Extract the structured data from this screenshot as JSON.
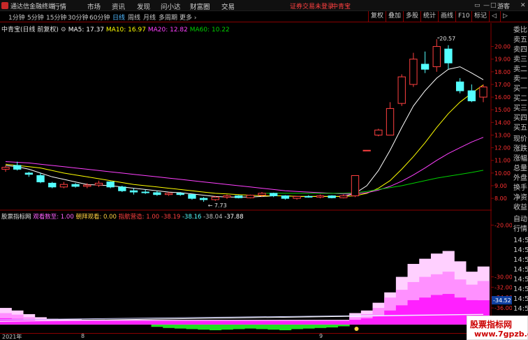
{
  "app": {
    "title": "通达信金融终端",
    "notice": "证券交易未登录",
    "stock_top": "中青宝",
    "guest": "游客"
  },
  "menu": [
    "行情",
    "市场",
    "资讯",
    "发现",
    "问小达",
    "财富圈",
    "交易"
  ],
  "window_controls": [
    "▭",
    "—",
    "□",
    "✕"
  ],
  "timeframes": [
    {
      "label": "1分钟",
      "active": false
    },
    {
      "label": "5分钟",
      "active": false
    },
    {
      "label": "15分钟",
      "active": false
    },
    {
      "label": "30分钟",
      "active": false
    },
    {
      "label": "60分钟",
      "active": false
    },
    {
      "label": "日线",
      "active": true
    },
    {
      "label": "周线",
      "active": false
    },
    {
      "label": "月线",
      "active": false
    },
    {
      "label": "多周期",
      "active": false
    },
    {
      "label": "更多 ›",
      "active": false
    }
  ],
  "tool_buttons": [
    "复权",
    "叠加",
    "多股",
    "统计",
    "画线",
    "F10",
    "标记",
    "◁",
    "▷"
  ],
  "main_header": {
    "title": "中青宝(日线 前复权)",
    "ma5": "MA5: 17.37",
    "ma10": "MA10: 16.97",
    "ma20": "MA20: 12.82",
    "ma60": "MA60: 10.22"
  },
  "sub_header": {
    "title": "股票指标网",
    "i1_name": "观看数至:",
    "i1_val": "1.00",
    "i2_name": "朝拜观看:",
    "i2_val": "0.00",
    "i3_name": "指航营造:",
    "i3_val": "1.00",
    "v1": "-38.19",
    "v2": "-38.16",
    "v3": "-38.04",
    "v4": "-37.88"
  },
  "annotations": {
    "high": "20.57",
    "low": "← 7.73"
  },
  "date_axis": [
    "2021年",
    "8",
    "9"
  ],
  "right_panel": [
    "委比",
    "卖五",
    "卖四",
    "卖三",
    "卖二",
    "卖一",
    "买一",
    "买二",
    "买三",
    "买四",
    "买五",
    "现价",
    "涨跌",
    "涨幅",
    "总量",
    "外盘",
    "换手",
    "净资",
    "收益",
    "",
    "自动",
    "行情",
    "14:5",
    "14:5",
    "14:5",
    "14:5",
    "14:5",
    "14:5",
    "14:5",
    "14:5"
  ],
  "watermark": {
    "line1": "股票指标网",
    "line2": "www.7gpzb.com"
  },
  "colors": {
    "up": "#ff4040",
    "down": "#54ffff",
    "ma5": "#ffffff",
    "ma10": "#ffff00",
    "ma20": "#ff40ff",
    "ma60": "#00d000",
    "frame": "#8a0000"
  },
  "chart_data": [
    {
      "type": "candlestick",
      "title": "中青宝(日线 前复权)",
      "y_ticks": [
        8.0,
        9.0,
        10.0,
        11.0,
        12.0,
        13.0,
        14.0,
        15.0,
        16.0,
        17.0,
        18.0,
        19.0,
        20.0
      ],
      "ylim": [
        7.4,
        21.3
      ],
      "high_label": 20.57,
      "low_label": 7.73,
      "candles": [
        {
          "o": 10.3,
          "h": 10.6,
          "l": 10.1,
          "c": 10.45
        },
        {
          "o": 10.6,
          "h": 10.9,
          "l": 10.2,
          "c": 10.3
        },
        {
          "o": 10.0,
          "h": 10.1,
          "l": 9.7,
          "c": 9.9
        },
        {
          "o": 9.8,
          "h": 10.0,
          "l": 9.2,
          "c": 9.3
        },
        {
          "o": 9.2,
          "h": 9.3,
          "l": 8.8,
          "c": 8.9
        },
        {
          "o": 8.9,
          "h": 9.3,
          "l": 8.8,
          "c": 9.1
        },
        {
          "o": 9.1,
          "h": 9.2,
          "l": 8.85,
          "c": 8.95
        },
        {
          "o": 8.95,
          "h": 9.2,
          "l": 8.8,
          "c": 9.05
        },
        {
          "o": 9.05,
          "h": 9.4,
          "l": 8.9,
          "c": 9.2
        },
        {
          "o": 9.3,
          "h": 9.35,
          "l": 8.8,
          "c": 8.9
        },
        {
          "o": 8.9,
          "h": 9.0,
          "l": 8.5,
          "c": 8.6
        },
        {
          "o": 8.6,
          "h": 8.8,
          "l": 8.3,
          "c": 8.5
        },
        {
          "o": 8.5,
          "h": 8.7,
          "l": 8.35,
          "c": 8.45
        },
        {
          "o": 8.45,
          "h": 8.6,
          "l": 8.2,
          "c": 8.3
        },
        {
          "o": 8.3,
          "h": 8.5,
          "l": 8.2,
          "c": 8.4
        },
        {
          "o": 8.4,
          "h": 8.5,
          "l": 8.2,
          "c": 8.3
        },
        {
          "o": 8.3,
          "h": 8.35,
          "l": 7.9,
          "c": 8.0
        },
        {
          "o": 8.0,
          "h": 8.1,
          "l": 7.73,
          "c": 7.9
        },
        {
          "o": 7.9,
          "h": 8.2,
          "l": 7.8,
          "c": 8.1
        },
        {
          "o": 8.1,
          "h": 8.3,
          "l": 7.95,
          "c": 8.2
        },
        {
          "o": 8.2,
          "h": 8.25,
          "l": 8.0,
          "c": 8.05
        },
        {
          "o": 8.05,
          "h": 8.3,
          "l": 8.0,
          "c": 8.25
        },
        {
          "o": 8.25,
          "h": 8.5,
          "l": 8.1,
          "c": 8.4
        },
        {
          "o": 8.4,
          "h": 8.45,
          "l": 8.1,
          "c": 8.2
        },
        {
          "o": 8.2,
          "h": 8.25,
          "l": 7.9,
          "c": 8.0
        },
        {
          "o": 8.0,
          "h": 8.2,
          "l": 7.9,
          "c": 8.15
        },
        {
          "o": 8.15,
          "h": 8.25,
          "l": 8.05,
          "c": 8.1
        },
        {
          "o": 8.1,
          "h": 8.3,
          "l": 8.0,
          "c": 8.2
        },
        {
          "o": 8.2,
          "h": 8.25,
          "l": 8.0,
          "c": 8.05
        },
        {
          "o": 8.05,
          "h": 8.3,
          "l": 8.0,
          "c": 8.2
        },
        {
          "o": 8.2,
          "h": 9.8,
          "l": 8.1,
          "c": 9.8
        },
        {
          "o": 11.8,
          "h": 11.8,
          "l": 11.8,
          "c": 11.8
        },
        {
          "o": 13.0,
          "h": 13.5,
          "l": 12.9,
          "c": 13.4
        },
        {
          "o": 13.0,
          "h": 15.6,
          "l": 13.0,
          "c": 15.1
        },
        {
          "o": 15.5,
          "h": 17.8,
          "l": 15.3,
          "c": 17.6
        },
        {
          "o": 17.0,
          "h": 19.5,
          "l": 16.8,
          "c": 19.0
        },
        {
          "o": 18.6,
          "h": 19.6,
          "l": 17.9,
          "c": 18.2
        },
        {
          "o": 18.4,
          "h": 20.57,
          "l": 18.0,
          "c": 20.0
        },
        {
          "o": 19.8,
          "h": 20.1,
          "l": 18.2,
          "c": 18.7
        },
        {
          "o": 17.2,
          "h": 17.5,
          "l": 16.3,
          "c": 16.5
        },
        {
          "o": 16.5,
          "h": 17.0,
          "l": 15.6,
          "c": 15.7
        },
        {
          "o": 16.0,
          "h": 17.0,
          "l": 15.6,
          "c": 16.8
        }
      ],
      "ma_series": [
        {
          "name": "MA5",
          "color": "#ffffff",
          "values": [
            10.6,
            10.5,
            10.3,
            10.0,
            9.7,
            9.5,
            9.3,
            9.1,
            9.05,
            9.0,
            8.9,
            8.8,
            8.7,
            8.6,
            8.5,
            8.45,
            8.35,
            8.25,
            8.15,
            8.1,
            8.1,
            8.1,
            8.15,
            8.2,
            8.2,
            8.15,
            8.15,
            8.15,
            8.15,
            8.15,
            8.4,
            9.0,
            10.2,
            11.8,
            13.6,
            15.3,
            16.5,
            17.5,
            18.2,
            18.4,
            17.9,
            17.37
          ]
        },
        {
          "name": "MA10",
          "color": "#ffff00",
          "values": [
            10.7,
            10.6,
            10.5,
            10.4,
            10.2,
            10.0,
            9.85,
            9.7,
            9.55,
            9.4,
            9.25,
            9.1,
            9.0,
            8.9,
            8.8,
            8.7,
            8.6,
            8.5,
            8.4,
            8.35,
            8.3,
            8.25,
            8.2,
            8.2,
            8.2,
            8.15,
            8.15,
            8.15,
            8.15,
            8.15,
            8.2,
            8.4,
            8.8,
            9.4,
            10.3,
            11.3,
            12.4,
            13.6,
            14.7,
            15.6,
            16.3,
            16.97
          ]
        },
        {
          "name": "MA20",
          "color": "#ff40ff",
          "values": [
            10.9,
            10.85,
            10.8,
            10.7,
            10.6,
            10.5,
            10.4,
            10.3,
            10.2,
            10.1,
            10.0,
            9.9,
            9.8,
            9.7,
            9.6,
            9.5,
            9.4,
            9.3,
            9.2,
            9.1,
            9.0,
            8.9,
            8.8,
            8.7,
            8.6,
            8.55,
            8.5,
            8.45,
            8.4,
            8.35,
            8.35,
            8.45,
            8.65,
            8.95,
            9.35,
            9.85,
            10.4,
            11.0,
            11.55,
            12.0,
            12.45,
            12.82
          ]
        },
        {
          "name": "MA60",
          "color": "#00d000",
          "values": [
            null,
            null,
            null,
            null,
            null,
            null,
            null,
            null,
            null,
            null,
            null,
            null,
            null,
            null,
            null,
            null,
            null,
            null,
            null,
            null,
            null,
            null,
            8.4,
            8.4,
            8.4,
            8.4,
            8.4,
            8.4,
            8.4,
            8.4,
            8.45,
            8.55,
            8.7,
            8.85,
            9.0,
            9.2,
            9.4,
            9.6,
            9.75,
            9.9,
            10.05,
            10.22
          ]
        }
      ]
    },
    {
      "type": "area",
      "title": "股票指标网",
      "y_ticks": [
        -20.0,
        -30.0,
        -32.0,
        -34.0,
        -36.0,
        -38.0
      ],
      "current_label": -34.52,
      "ylim": [
        -39.5,
        -19
      ],
      "layers": [
        {
          "name": "观看数至",
          "color": "#ffd0ff",
          "values": [
            -36.0,
            -36.5,
            -37.2,
            -37.8,
            -38.1,
            -38.2,
            -38.2,
            -38.25,
            -38.25,
            -38.3,
            -38.3,
            -38.3,
            -38.3,
            -38.3,
            -38.3,
            -38.3,
            -38.3,
            -38.3,
            -38.3,
            -38.3,
            -38.3,
            -38.3,
            -38.3,
            -38.3,
            -38.3,
            -38.3,
            -38.3,
            -38.3,
            -38.3,
            -38.3,
            -37.0,
            -36.5,
            -35.0,
            -33.0,
            -30.0,
            -27.5,
            -26.5,
            -25.5,
            -25.0,
            -27.0,
            -29.0,
            -28.0
          ]
        },
        {
          "name": "朝拜观看",
          "color": "#ff90ff",
          "values": [
            -37.0,
            -37.3,
            -37.8,
            -38.1,
            -38.3,
            -38.35,
            -38.4,
            -38.4,
            -38.4,
            -38.4,
            -38.4,
            -38.4,
            -38.4,
            -38.4,
            -38.4,
            -38.4,
            -38.4,
            -38.4,
            -38.4,
            -38.4,
            -38.4,
            -38.4,
            -38.4,
            -38.4,
            -38.4,
            -38.4,
            -38.4,
            -38.4,
            -38.4,
            -38.4,
            -37.8,
            -37.2,
            -36.0,
            -34.0,
            -32.5,
            -31.0,
            -30.0,
            -29.5,
            -29.0,
            -30.5,
            -31.5,
            -30.8
          ]
        },
        {
          "name": "指航营造",
          "color": "#ff20ff",
          "values": [
            -38.0,
            -38.1,
            -38.3,
            -38.4,
            -38.5,
            -38.5,
            -38.5,
            -38.5,
            -38.5,
            -38.5,
            -38.5,
            -38.5,
            -38.5,
            -38.5,
            -38.5,
            -38.5,
            -38.5,
            -38.5,
            -38.5,
            -38.5,
            -38.5,
            -38.5,
            -38.5,
            -38.5,
            -38.5,
            -38.5,
            -38.5,
            -38.5,
            -38.5,
            -38.5,
            -38.3,
            -38.0,
            -37.5,
            -36.5,
            -35.5,
            -34.5,
            -34.0,
            -33.5,
            -33.3,
            -34.0,
            -34.5,
            -34.52
          ]
        }
      ],
      "green_bars": [
        0,
        0,
        0,
        0,
        0,
        0,
        0,
        0,
        0,
        0,
        0,
        0,
        0,
        0.4,
        0.6,
        0.7,
        0.8,
        0.9,
        1.0,
        0.9,
        0.8,
        0.7,
        0.8,
        0.9,
        1.0,
        0.8,
        0.7,
        0.6,
        0.5,
        0.3,
        0,
        0,
        0,
        0,
        0,
        0,
        0,
        0,
        0,
        0,
        0,
        0
      ]
    }
  ]
}
